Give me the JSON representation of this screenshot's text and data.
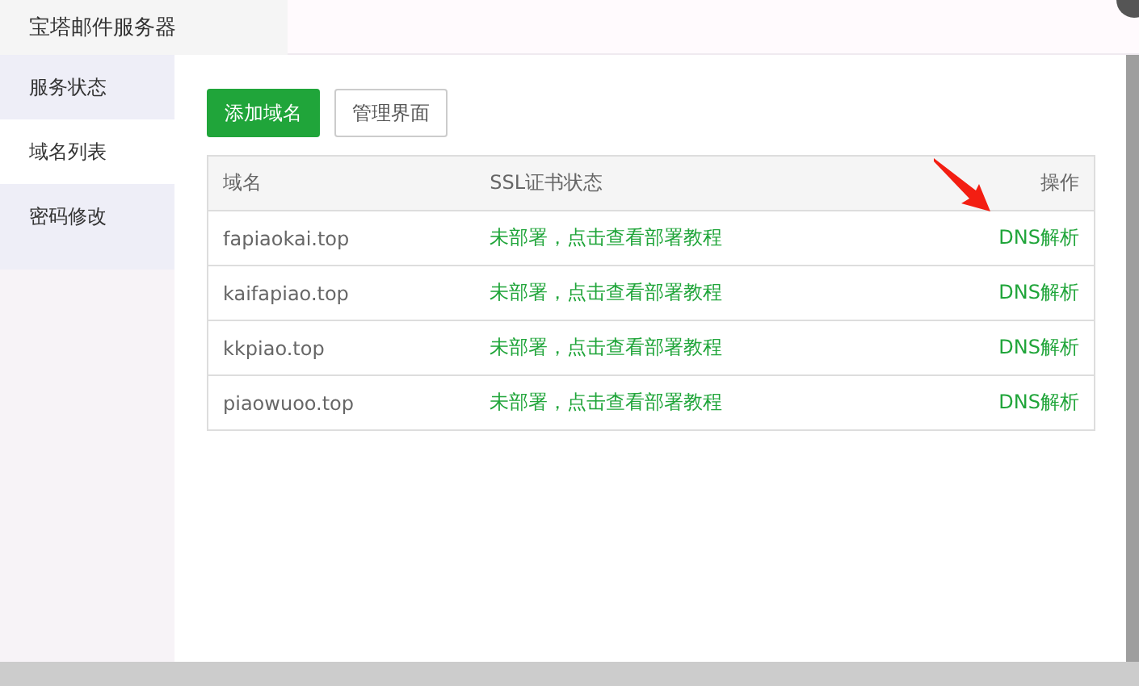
{
  "window": {
    "title": "宝塔邮件服务器"
  },
  "sidebar": {
    "items": [
      {
        "label": "服务状态",
        "selected": false
      },
      {
        "label": "域名列表",
        "selected": true
      },
      {
        "label": "密码修改",
        "selected": false
      }
    ]
  },
  "toolbar": {
    "buttons": [
      {
        "label": "添加域名",
        "kind": "primary"
      },
      {
        "label": "管理界面",
        "kind": "default"
      }
    ]
  },
  "table": {
    "columns": [
      "域名",
      "SSL证书状态",
      "操作"
    ],
    "rows": [
      {
        "domain": "fapiaokai.top",
        "ssl": "未部署，点击查看部署教程",
        "action": "DNS解析"
      },
      {
        "domain": "kaifapiao.top",
        "ssl": "未部署，点击查看部署教程",
        "action": "DNS解析"
      },
      {
        "domain": "kkpiao.top",
        "ssl": "未部署，点击查看部署教程",
        "action": "DNS解析"
      },
      {
        "domain": "piaowuoo.top",
        "ssl": "未部署，点击查看部署教程",
        "action": "DNS解析"
      }
    ]
  }
}
